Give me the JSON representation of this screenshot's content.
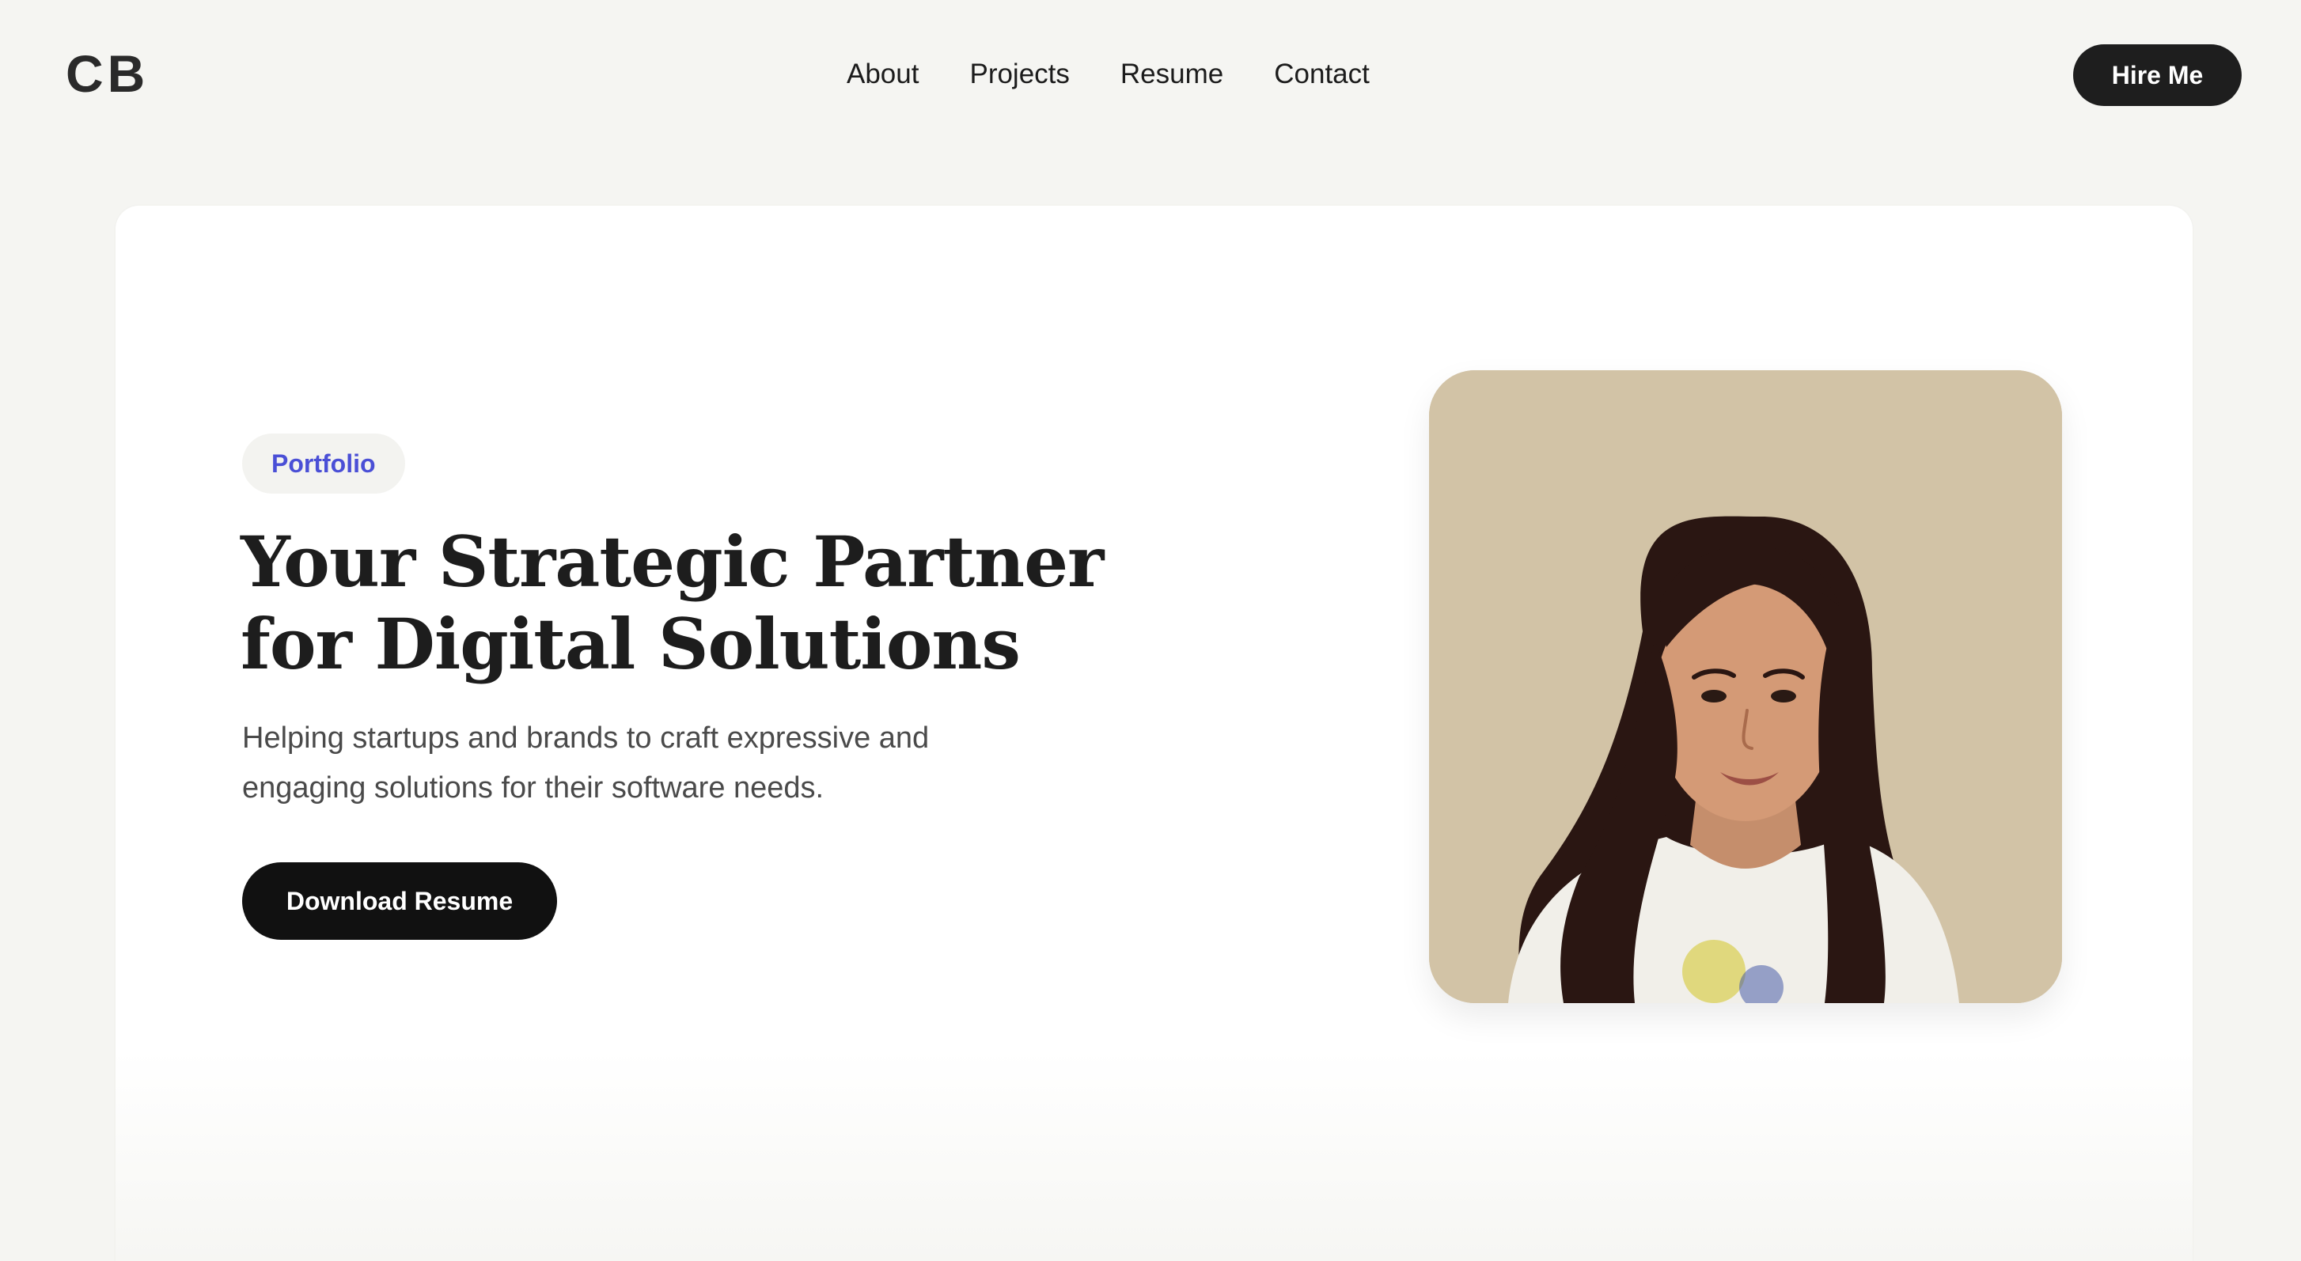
{
  "header": {
    "logo": "CB",
    "nav": [
      {
        "label": "About"
      },
      {
        "label": "Projects"
      },
      {
        "label": "Resume"
      },
      {
        "label": "Contact"
      }
    ],
    "hire_button": "Hire Me"
  },
  "hero": {
    "tag": "Portfolio",
    "headline_line1": "Your Strategic Partner",
    "headline_line2": "for Digital Solutions",
    "subtext_line1": "Helping startups and brands to craft expressive and",
    "subtext_line2": "engaging solutions for their software needs.",
    "download_button": "Download Resume"
  },
  "colors": {
    "page_bg": "#f5f5f2",
    "card_bg": "#ffffff",
    "accent": "#4a4fd6",
    "button_dark": "#111111",
    "portrait_bg": "#d2c3a6"
  }
}
